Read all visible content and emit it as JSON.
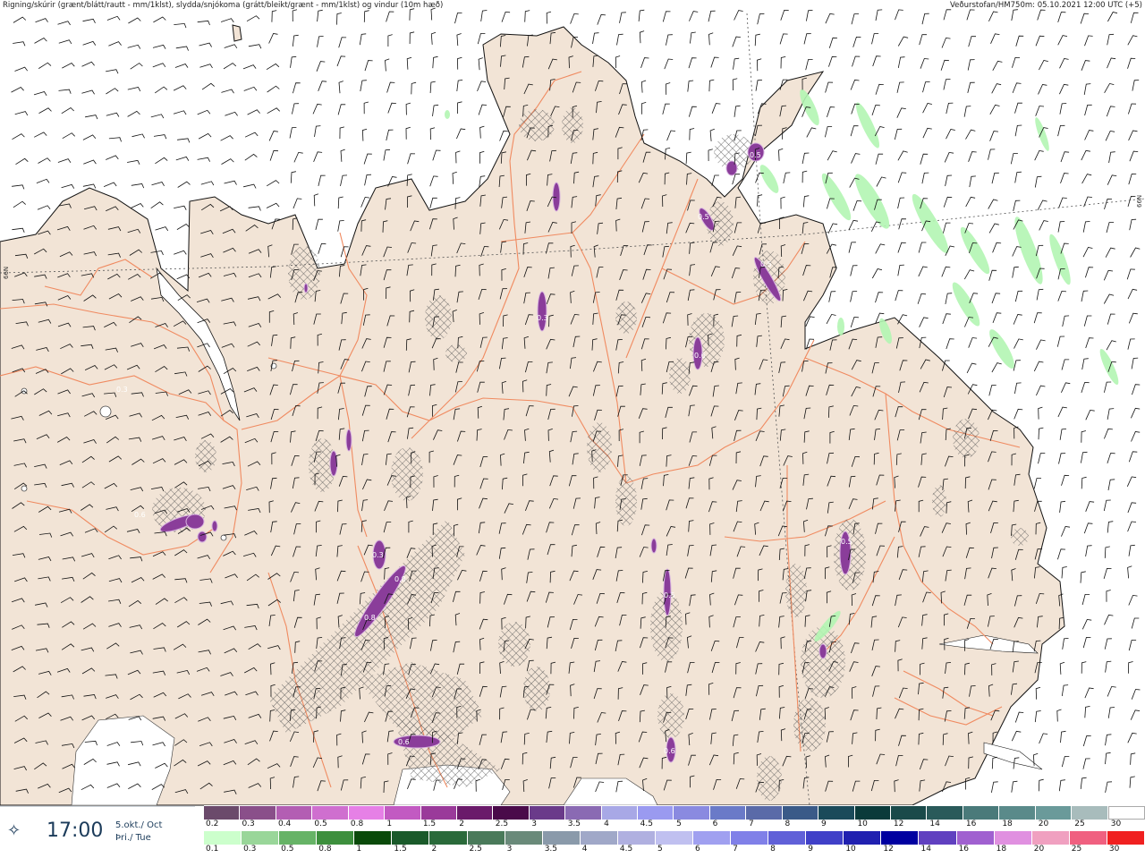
{
  "header": {
    "description": "Rigning/skúrir (grænt/blátt/rautt - mm/1klst), slydda/snjókoma (grátt/bleikt/grænt - mm/1klst) og vindur (10m hæð)",
    "source": "Veðurstofan/HM750m: 05.10.2021 12:00 UTC (+5)"
  },
  "map": {
    "lat_label_left": "66N",
    "lat_label_right": "66N",
    "land_color": "#f2e4d6",
    "sea_color": "#ffffff",
    "road_color": "#f08a60",
    "value_labels": [
      "0.3",
      "0.8",
      "0.8",
      "0.3",
      "0.6",
      "0.6",
      "0.5",
      "0.5",
      "0.5",
      "0.5",
      "0.5",
      "0.6",
      "0.6",
      "0.3"
    ]
  },
  "time_panel": {
    "icon": "wind-compass-icon",
    "time": "17:00",
    "date_is": "5.okt./ Oct",
    "day_is": "Þri./ Tue"
  },
  "legend": {
    "row1": {
      "labels": [
        "0.2",
        "0.3",
        "0.4",
        "0.5",
        "0.8",
        "1",
        "1.5",
        "2",
        "2.5",
        "3",
        "3.5",
        "4",
        "4.5",
        "5",
        "6",
        "7",
        "8",
        "9",
        "10",
        "12",
        "14",
        "16",
        "18",
        "20",
        "25",
        "30"
      ],
      "colors": [
        "#6b4a6b",
        "#8a4f8a",
        "#b35eb3",
        "#cf6fcf",
        "#e680e6",
        "#c25ac2",
        "#9a3a9a",
        "#6a1a6a",
        "#4a0a4a",
        "#6a3a8a",
        "#8a6ab3",
        "#a8a8e6",
        "#9a9af0",
        "#8a8ae0",
        "#6a7ac8",
        "#5a6aa8",
        "#3a5a88",
        "#1a4a5a",
        "#0a3a3a",
        "#1a4a4a",
        "#2a5a5a",
        "#4a7a7a",
        "#5a8a8a",
        "#6a9a9a",
        "#a8bcbc",
        "#ffffff"
      ]
    },
    "row2": {
      "labels": [
        "0.1",
        "0.3",
        "0.5",
        "0.8",
        "1",
        "1.5",
        "2",
        "2.5",
        "3",
        "3.5",
        "4",
        "4.5",
        "5",
        "6",
        "7",
        "8",
        "9",
        "10",
        "12",
        "14",
        "16",
        "18",
        "20",
        "25",
        "30"
      ],
      "colors": [
        "#ccffcc",
        "#99d699",
        "#66b366",
        "#3d8f3d",
        "#0a4a0a",
        "#1a5a2a",
        "#2a6a3a",
        "#4a7a5a",
        "#6a8a7a",
        "#8a9aaa",
        "#a0a8c8",
        "#b0b0e0",
        "#c0c0f0",
        "#a0a0f0",
        "#8080e8",
        "#6060d8",
        "#4040c8",
        "#2020b0",
        "#0000a0",
        "#6040c0",
        "#a060d0",
        "#e090e0",
        "#f0a0c0",
        "#f06080",
        "#f02020"
      ]
    }
  }
}
